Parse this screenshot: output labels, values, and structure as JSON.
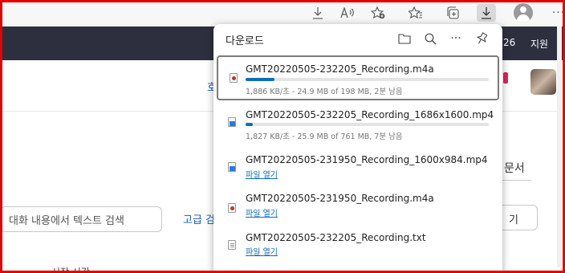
{
  "page": {
    "darkbar_right_1": "26",
    "darkbar_right_2": "지원",
    "search_placeholder": "대화 내용에서 텍스트 검색",
    "advanced_link": "고급 검",
    "doc_tab": "문서",
    "right_button": "기",
    "left_partial": "호",
    "bottom_text": "시작 시간"
  },
  "downloads": {
    "title": "다운로드",
    "header_icons": [
      "folder-icon",
      "search-icon",
      "more-icon",
      "pin-icon"
    ],
    "items": [
      {
        "name": "GMT20220505-232205_Recording.m4a",
        "type": "audio",
        "status": "1,886 KB/초 - 24.9 MB of 198 MB, 2분 남음",
        "progress": 0.12,
        "selected": true
      },
      {
        "name": "GMT20220505-232205_Recording_1686x1600.mp4",
        "type": "video",
        "status": "1,827 KB/초 - 25.9 MB of 761 MB, 7분 남음",
        "progress": 0.03,
        "selected": false
      },
      {
        "name": "GMT20220505-231950_Recording_1600x984.mp4",
        "type": "video",
        "open_label": "파일 열기"
      },
      {
        "name": "GMT20220505-231950_Recording.m4a",
        "type": "audio",
        "open_label": "파일 열기"
      },
      {
        "name": "GMT20220505-232205_Recording.txt",
        "type": "text",
        "open_label": "파일 열기"
      }
    ]
  },
  "colors": {
    "accent": "#0f6cbd",
    "darkbar": "#2d2f3f",
    "frame": "#e60000"
  }
}
